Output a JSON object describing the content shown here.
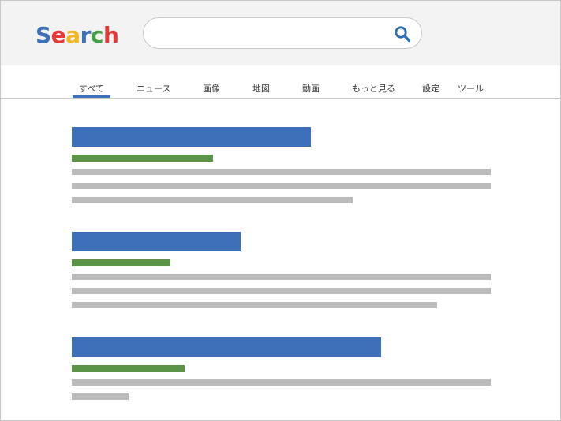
{
  "header": {
    "logo": {
      "letters": [
        {
          "char": "S",
          "color": "#3c70b8"
        },
        {
          "char": "e",
          "color": "#e53935"
        },
        {
          "char": "a",
          "color": "#f2b824"
        },
        {
          "char": "r",
          "color": "#3c70b8"
        },
        {
          "char": "c",
          "color": "#43a047"
        },
        {
          "char": "h",
          "color": "#e53935"
        }
      ]
    },
    "search": {
      "value": "",
      "placeholder": "",
      "icon": "search-icon",
      "icon_color": "#2f6db5"
    }
  },
  "tabs": {
    "active_index": 0,
    "accent_color": "#3b71b9",
    "items": [
      {
        "label": "すべて"
      },
      {
        "label": "ニュース"
      },
      {
        "label": "画像"
      },
      {
        "label": "地図"
      },
      {
        "label": "動画"
      },
      {
        "label": "もっと見る"
      },
      {
        "label": "設定"
      },
      {
        "label": "ツール"
      }
    ]
  },
  "colors": {
    "result_title": "#3d70b8",
    "result_url": "#5b9446",
    "result_snippet": "#bbbbbb"
  },
  "results": [
    {
      "title": "",
      "url": "",
      "snippet_lines": 3
    },
    {
      "title": "",
      "url": "",
      "snippet_lines": 3
    },
    {
      "title": "",
      "url": "",
      "snippet_lines": 2
    }
  ]
}
